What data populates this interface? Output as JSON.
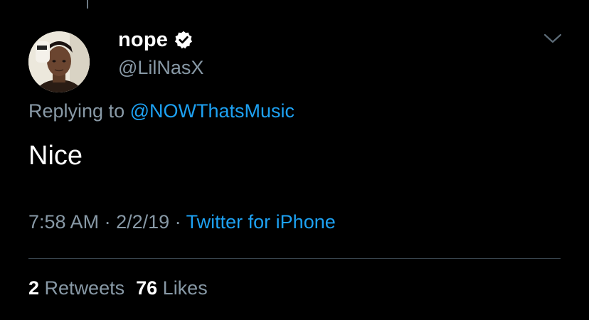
{
  "tweet": {
    "display_name": "nope",
    "handle": "@LilNasX",
    "replying_prefix": "Replying to ",
    "replying_mention": "@NOWThatsMusic",
    "text": "Nice",
    "time": "7:58 AM",
    "separator": " · ",
    "date": "2/2/19",
    "source": "Twitter for iPhone",
    "retweet_count": "2",
    "retweet_label": "Retweets",
    "like_count": "76",
    "like_label": "Likes"
  },
  "icons": {
    "verified": "verified-badge-icon",
    "menu": "chevron-down-icon"
  },
  "colors": {
    "background": "#000000",
    "text": "#ffffff",
    "secondary": "#8899a6",
    "link": "#1da1f2",
    "divider": "#38444d"
  }
}
